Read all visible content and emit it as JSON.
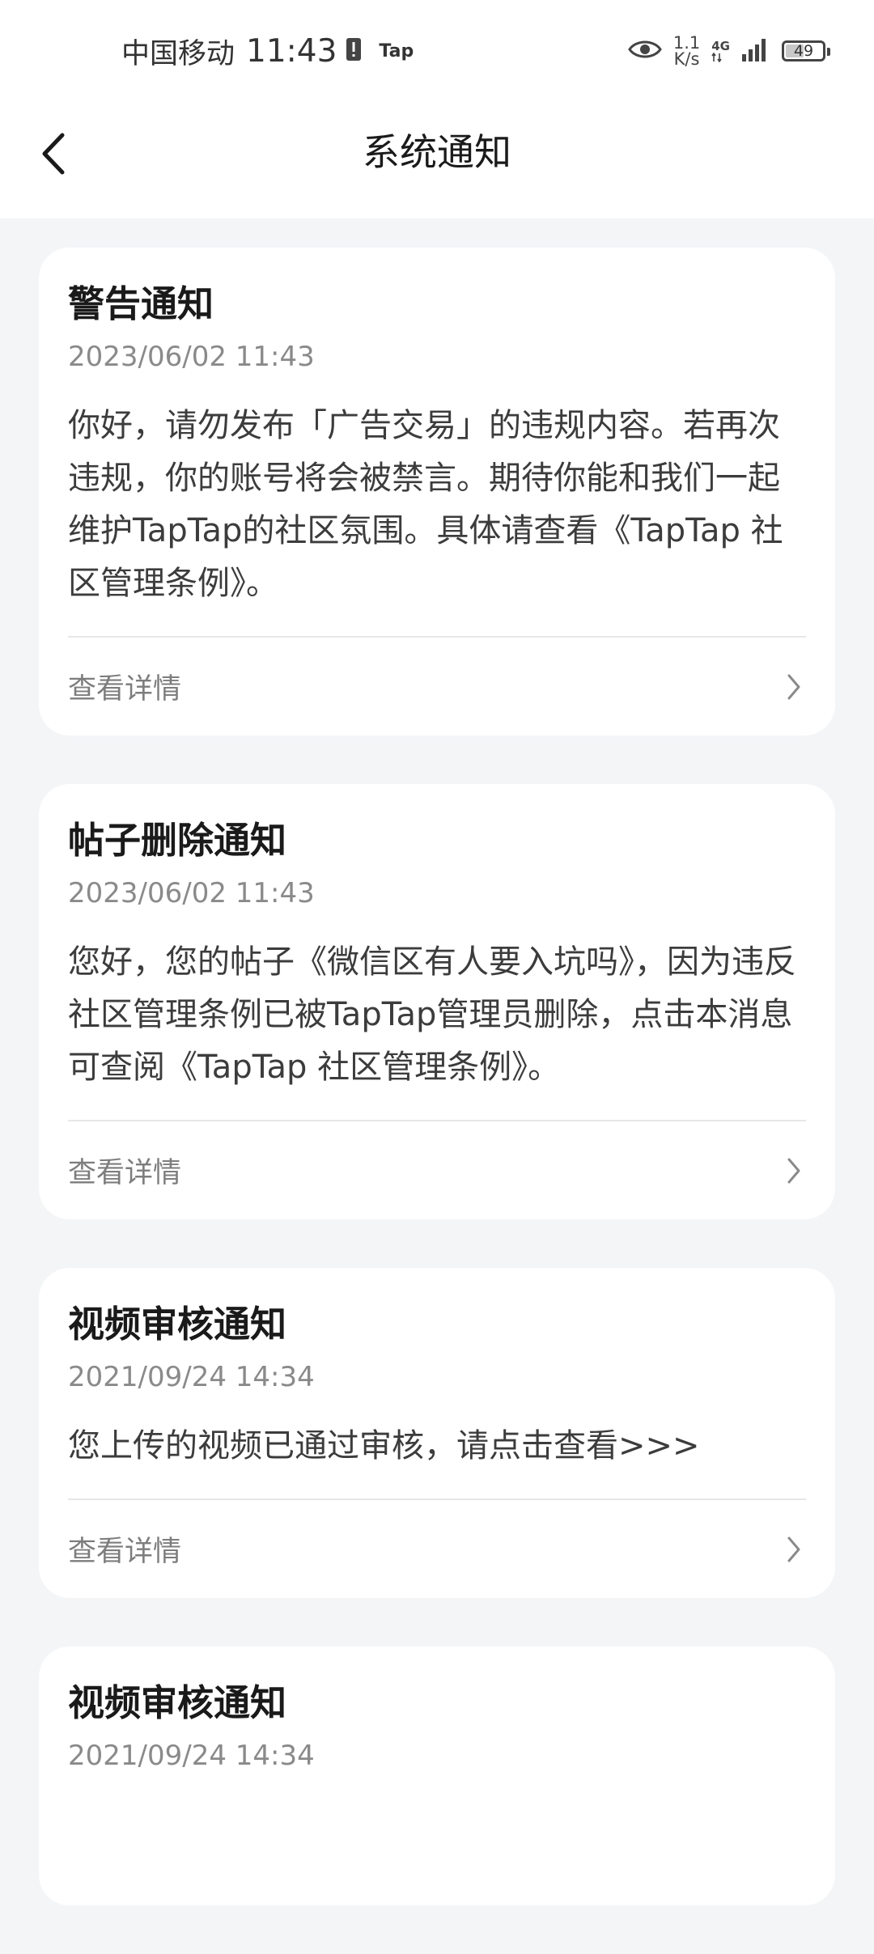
{
  "status_bar": {
    "carrier": "中国移动",
    "time": "11:43",
    "tap_label": "Tap",
    "speed_value": "1.1",
    "speed_unit": "K/s",
    "network_type": "4G",
    "battery_level": "49",
    "battery_percent": 49
  },
  "header": {
    "title": "系统通知"
  },
  "notifications": [
    {
      "title": "警告通知",
      "date": "2023/06/02 11:43",
      "body": "你好，请勿发布「广告交易」的违规内容。若再次违规，你的账号将会被禁言。期待你能和我们一起维护TapTap的社区氛围。具体请查看《TapTap 社区管理条例》。",
      "action": "查看详情"
    },
    {
      "title": "帖子删除通知",
      "date": "2023/06/02 11:43",
      "body": "您好，您的帖子《微信区有人要入坑吗》，因为违反社区管理条例已被TapTap管理员删除，点击本消息可查阅《TapTap 社区管理条例》。",
      "action": "查看详情"
    },
    {
      "title": "视频审核通知",
      "date": "2021/09/24 14:34",
      "body": "您上传的视频已通过审核，请点击查看>>>",
      "action": "查看详情"
    },
    {
      "title": "视频审核通知",
      "date": "2021/09/24 14:34"
    }
  ]
}
